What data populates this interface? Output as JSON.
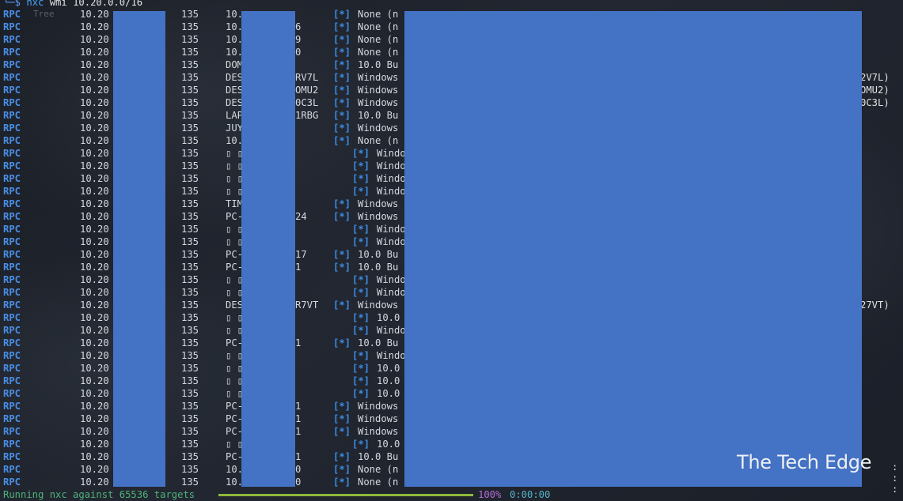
{
  "prompt": {
    "symbol": "└─$",
    "command": "nxc",
    "args": "wmi 10.20.0.0/16",
    "ghost": "Tree"
  },
  "rows": [
    {
      "proto": "RPC",
      "ip": "10.20",
      "port": "135",
      "host": "10.",
      "tail": "",
      "star": "[*]",
      "info": "None (n"
    },
    {
      "proto": "RPC",
      "ip": "10.20",
      "port": "135",
      "host": "10.",
      "tail": "6",
      "star": "[*]",
      "info": "None (n"
    },
    {
      "proto": "RPC",
      "ip": "10.20",
      "port": "135",
      "host": "10.",
      "tail": "9",
      "star": "[*]",
      "info": "None (n"
    },
    {
      "proto": "RPC",
      "ip": "10.20",
      "port": "135",
      "host": "10.",
      "tail": "0",
      "star": "[*]",
      "info": "None (n"
    },
    {
      "proto": "RPC",
      "ip": "10.20",
      "port": "135",
      "host": "DOM",
      "tail": "",
      "star": "[*]",
      "info": "10.0 Bu"
    },
    {
      "proto": "RPC",
      "ip": "10.20",
      "port": "135",
      "host": "DES",
      "tail": "RV7L",
      "star": "[*]",
      "info": "Windows",
      "right": "2V7L)"
    },
    {
      "proto": "RPC",
      "ip": "10.20",
      "port": "135",
      "host": "DES",
      "tail": "OMU2",
      "star": "[*]",
      "info": "Windows",
      "right": "OMU2)"
    },
    {
      "proto": "RPC",
      "ip": "10.20",
      "port": "135",
      "host": "DES",
      "tail": "0C3L",
      "star": "[*]",
      "info": "Windows",
      "right": "0C3L)"
    },
    {
      "proto": "RPC",
      "ip": "10.20",
      "port": "135",
      "host": "LAP",
      "tail": "1RBG",
      "star": "[*]",
      "info": "10.0 Bu"
    },
    {
      "proto": "RPC",
      "ip": "10.20",
      "port": "135",
      "host": "JUY",
      "tail": "",
      "star": "[*]",
      "info": "Windows"
    },
    {
      "proto": "RPC",
      "ip": "10.20",
      "port": "135",
      "host": "10.",
      "tail": "",
      "star": "[*]",
      "info": "None (n"
    },
    {
      "proto": "RPC",
      "ip": "10.20",
      "port": "135",
      "host": "▯ ▯",
      "tail": "",
      "star": "[*]",
      "info": "Windo",
      "indent": true
    },
    {
      "proto": "RPC",
      "ip": "10.20",
      "port": "135",
      "host": "▯ ▯",
      "tail": "",
      "star": "[*]",
      "info": "Windo",
      "indent": true
    },
    {
      "proto": "RPC",
      "ip": "10.20",
      "port": "135",
      "host": "▯ ▯",
      "tail": "",
      "star": "[*]",
      "info": "Windo",
      "indent": true
    },
    {
      "proto": "RPC",
      "ip": "10.20",
      "port": "135",
      "host": "▯ ▯",
      "tail": "",
      "star": "[*]",
      "info": "Windo",
      "indent": true
    },
    {
      "proto": "RPC",
      "ip": "10.20",
      "port": "135",
      "host": "TIM",
      "tail": "",
      "star": "[*]",
      "info": "Windows"
    },
    {
      "proto": "RPC",
      "ip": "10.20",
      "port": "135",
      "host": "PC-",
      "tail": "24",
      "star": "[*]",
      "info": "Windows"
    },
    {
      "proto": "RPC",
      "ip": "10.20",
      "port": "135",
      "host": "▯ ▯",
      "tail": "",
      "star": "[*]",
      "info": "Windo",
      "indent": true
    },
    {
      "proto": "RPC",
      "ip": "10.20",
      "port": "135",
      "host": "▯ ▯",
      "tail": "",
      "star": "[*]",
      "info": "Windo",
      "indent": true
    },
    {
      "proto": "RPC",
      "ip": "10.20",
      "port": "135",
      "host": "PC-",
      "tail": "17",
      "star": "[*]",
      "info": "10.0 Bu"
    },
    {
      "proto": "RPC",
      "ip": "10.20",
      "port": "135",
      "host": "PC-",
      "tail": "1",
      "star": "[*]",
      "info": "10.0 Bu"
    },
    {
      "proto": "RPC",
      "ip": "10.20",
      "port": "135",
      "host": "▯ ▯",
      "tail": "",
      "star": "[*]",
      "info": "Windo",
      "indent": true
    },
    {
      "proto": "RPC",
      "ip": "10.20",
      "port": "135",
      "host": "▯ ▯",
      "tail": "",
      "star": "[*]",
      "info": "Windo",
      "indent": true
    },
    {
      "proto": "RPC",
      "ip": "10.20",
      "port": "135",
      "host": "DES",
      "tail": "R7VT",
      "star": "[*]",
      "info": "Windows",
      "right": "27VT)"
    },
    {
      "proto": "RPC",
      "ip": "10.20",
      "port": "135",
      "host": "▯ ▯",
      "tail": "",
      "star": "[*]",
      "info": "10.0",
      "indent": true
    },
    {
      "proto": "RPC",
      "ip": "10.20",
      "port": "135",
      "host": "▯ ▯",
      "tail": "",
      "star": "[*]",
      "info": "Windo",
      "indent": true
    },
    {
      "proto": "RPC",
      "ip": "10.20",
      "port": "135",
      "host": "PC-",
      "tail": "1",
      "star": "[*]",
      "info": "10.0 Bu"
    },
    {
      "proto": "RPC",
      "ip": "10.20",
      "port": "135",
      "host": "▯ ▯",
      "tail": "",
      "star": "[*]",
      "info": "Windo",
      "indent": true
    },
    {
      "proto": "RPC",
      "ip": "10.20",
      "port": "135",
      "host": "▯ ▯",
      "tail": "",
      "star": "[*]",
      "info": "10.0",
      "indent": true
    },
    {
      "proto": "RPC",
      "ip": "10.20",
      "port": "135",
      "host": "▯ ▯",
      "tail": "",
      "star": "[*]",
      "info": "10.0",
      "indent": true
    },
    {
      "proto": "RPC",
      "ip": "10.20",
      "port": "135",
      "host": "▯ ▯",
      "tail": "",
      "star": "[*]",
      "info": "10.0",
      "indent": true
    },
    {
      "proto": "RPC",
      "ip": "10.20",
      "port": "135",
      "host": "PC-",
      "tail": "1",
      "star": "[*]",
      "info": "Windows"
    },
    {
      "proto": "RPC",
      "ip": "10.20",
      "port": "135",
      "host": "PC-",
      "tail": "1",
      "star": "[*]",
      "info": "Windows"
    },
    {
      "proto": "RPC",
      "ip": "10.20",
      "port": "135",
      "host": "PC-",
      "tail": "1",
      "star": "[*]",
      "info": "Windows"
    },
    {
      "proto": "RPC",
      "ip": "10.20",
      "port": "135",
      "host": "▯ ▯",
      "tail": "",
      "star": "[*]",
      "info": "10.0",
      "indent": true
    },
    {
      "proto": "RPC",
      "ip": "10.20",
      "port": "135",
      "host": "PC-",
      "tail": "1",
      "star": "[*]",
      "info": "10.0 Bu"
    },
    {
      "proto": "RPC",
      "ip": "10.20",
      "port": "135",
      "host": "10.",
      "tail": "0",
      "star": "[*]",
      "info": "None (n"
    },
    {
      "proto": "RPC",
      "ip": "10.20",
      "port": "135",
      "host": "10.",
      "tail": "0",
      "star": "[*]",
      "info": "None (n"
    }
  ],
  "status": {
    "text": "Running nxc against 65536 targets",
    "progress_fraction": 1.0,
    "percent": "100%",
    "elapsed": "0:00:00"
  },
  "watermark": "The Tech Edge",
  "colors": {
    "redaction": "#4472c4",
    "proto": "#4a8fe7",
    "progress": "#8fb83a"
  }
}
